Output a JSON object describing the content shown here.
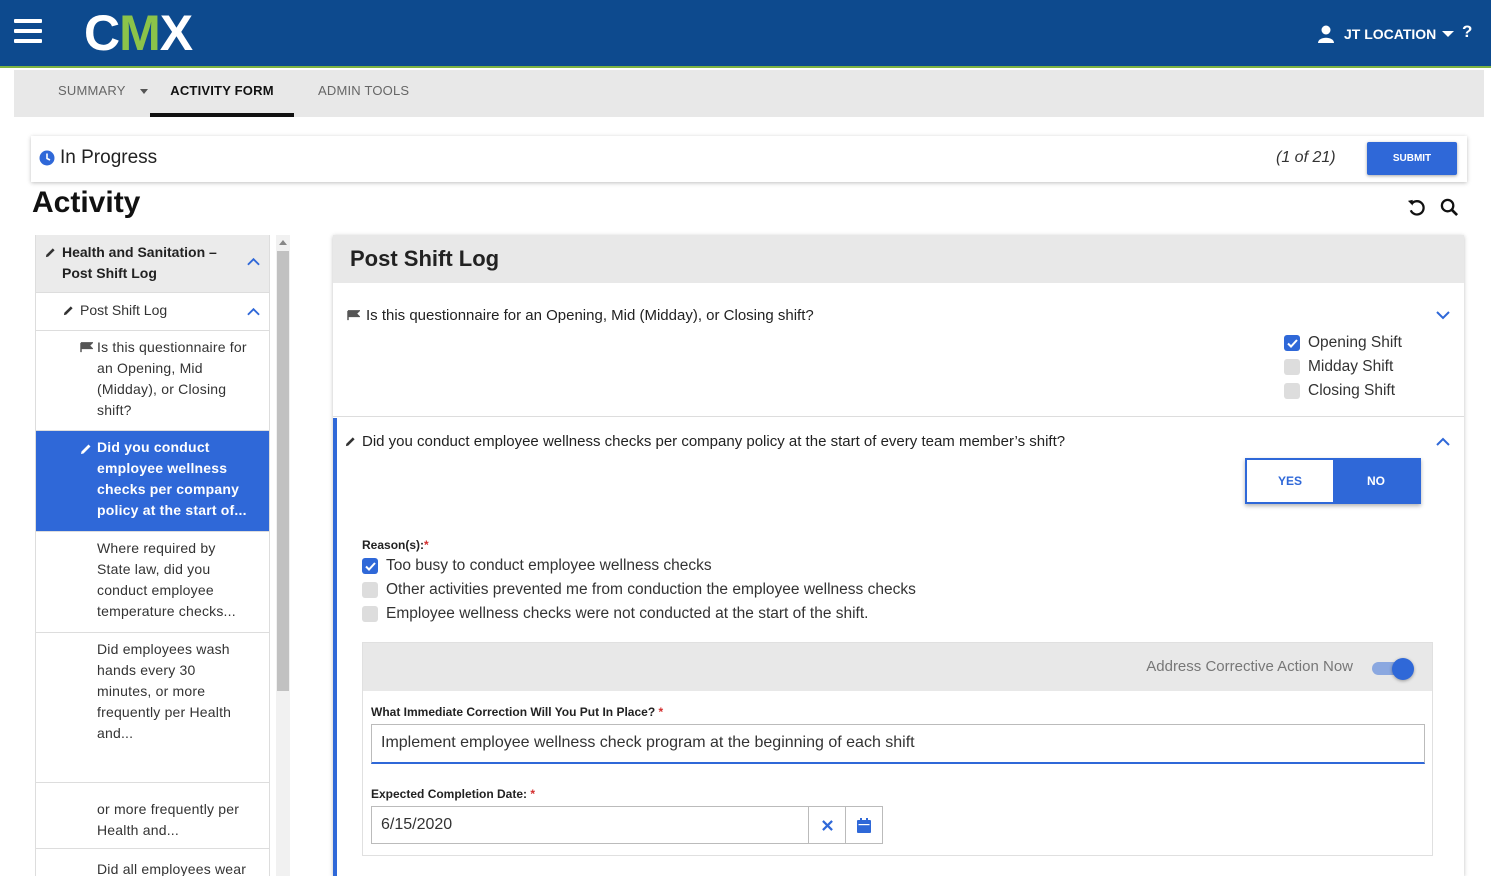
{
  "app": {
    "logo_prefix": "C",
    "logo_mid": "M",
    "logo_suffix": "X",
    "location": "JT LOCATION",
    "help": "?"
  },
  "tabs": [
    {
      "label": "SUMMARY"
    },
    {
      "label": "ACTIVITY FORM",
      "active": true
    },
    {
      "label": "ADMIN TOOLS"
    }
  ],
  "status": {
    "label": "In Progress",
    "counter": "(1 of 21)",
    "submit_label": "SUBMIT"
  },
  "page": {
    "title": "Activity"
  },
  "nav": {
    "section": "Health and Sanitation – Post Shift Log",
    "sub": "Post Shift Log",
    "items": [
      {
        "text": "Is this questionnaire for an Opening, Mid (Midday), or Closing shift?",
        "icon": "flag-icon"
      },
      {
        "text": "Did you conduct employee wellness checks per company policy at the start of...",
        "icon": "pencil-icon",
        "selected": true
      },
      {
        "text": "Where required by State law, did you conduct employee temperature checks..."
      },
      {
        "text": "Did employees wash hands every 30 minutes, or more frequently per Health and..."
      },
      {
        "text": "or more frequently per Health and..."
      },
      {
        "text": "Did all employees wear"
      }
    ]
  },
  "main": {
    "title": "Post Shift Log",
    "q1": {
      "text": "Is this questionnaire for an Opening, Mid (Midday), or Closing shift?",
      "options": [
        {
          "label": "Opening Shift",
          "checked": true
        },
        {
          "label": "Midday Shift",
          "checked": false
        },
        {
          "label": "Closing Shift",
          "checked": false
        }
      ]
    },
    "q2": {
      "text": "Did you conduct employee wellness checks per company policy at the start of every team member’s shift?",
      "yes_label": "YES",
      "no_label": "NO",
      "selected": "NO",
      "reasons_label": "Reason(s):",
      "reasons": [
        {
          "label": "Too busy to conduct employee wellness checks",
          "checked": true
        },
        {
          "label": "Other activities prevented me from conduction the employee wellness checks",
          "checked": false
        },
        {
          "label": "Employee wellness checks were not conducted at the start of the shift.",
          "checked": false
        }
      ],
      "corrective": {
        "toggle_label": "Address Corrective Action Now",
        "toggle_on": true,
        "correction_label": "What Immediate Correction Will You Put In Place?",
        "correction_value": "Implement employee wellness check program at the beginning of each shift",
        "date_label": "Expected Completion Date:",
        "date_value": "6/15/2020"
      }
    }
  },
  "colors": {
    "header": "#0d4a8e",
    "accent": "#2f68d8",
    "brand_green": "#8bc34a"
  }
}
